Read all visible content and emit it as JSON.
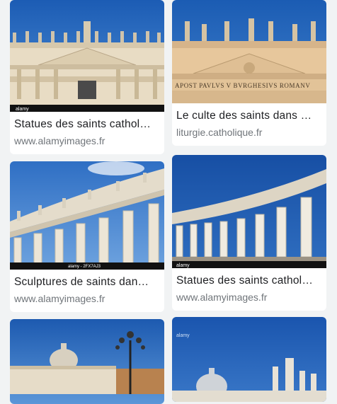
{
  "results": {
    "left": [
      {
        "title": "Statues des saints cathol…",
        "source": "www.alamyimages.fr",
        "watermark": "alamy",
        "caption": ""
      },
      {
        "title": "Sculptures de saints dan…",
        "source": "www.alamyimages.fr",
        "watermark": "alamy",
        "caption": "alamy - 2FX7AJ3"
      },
      {
        "title": "",
        "source": "",
        "watermark": "",
        "caption": ""
      }
    ],
    "right": [
      {
        "title": "Le culte des saints dans …",
        "source": "liturgie.catholique.fr",
        "inscription": "APOST PAVLVS V BVRGHESIVS ROMANV",
        "watermark": ""
      },
      {
        "title": "Statues des saints cathol…",
        "source": "www.alamyimages.fr",
        "watermark": "alamy"
      },
      {
        "title": "",
        "source": "",
        "watermark": "alamy"
      }
    ]
  },
  "colors": {
    "sky": "#1f5fb0",
    "stone": "#e9ddc6",
    "background": "#f1f3f4"
  }
}
